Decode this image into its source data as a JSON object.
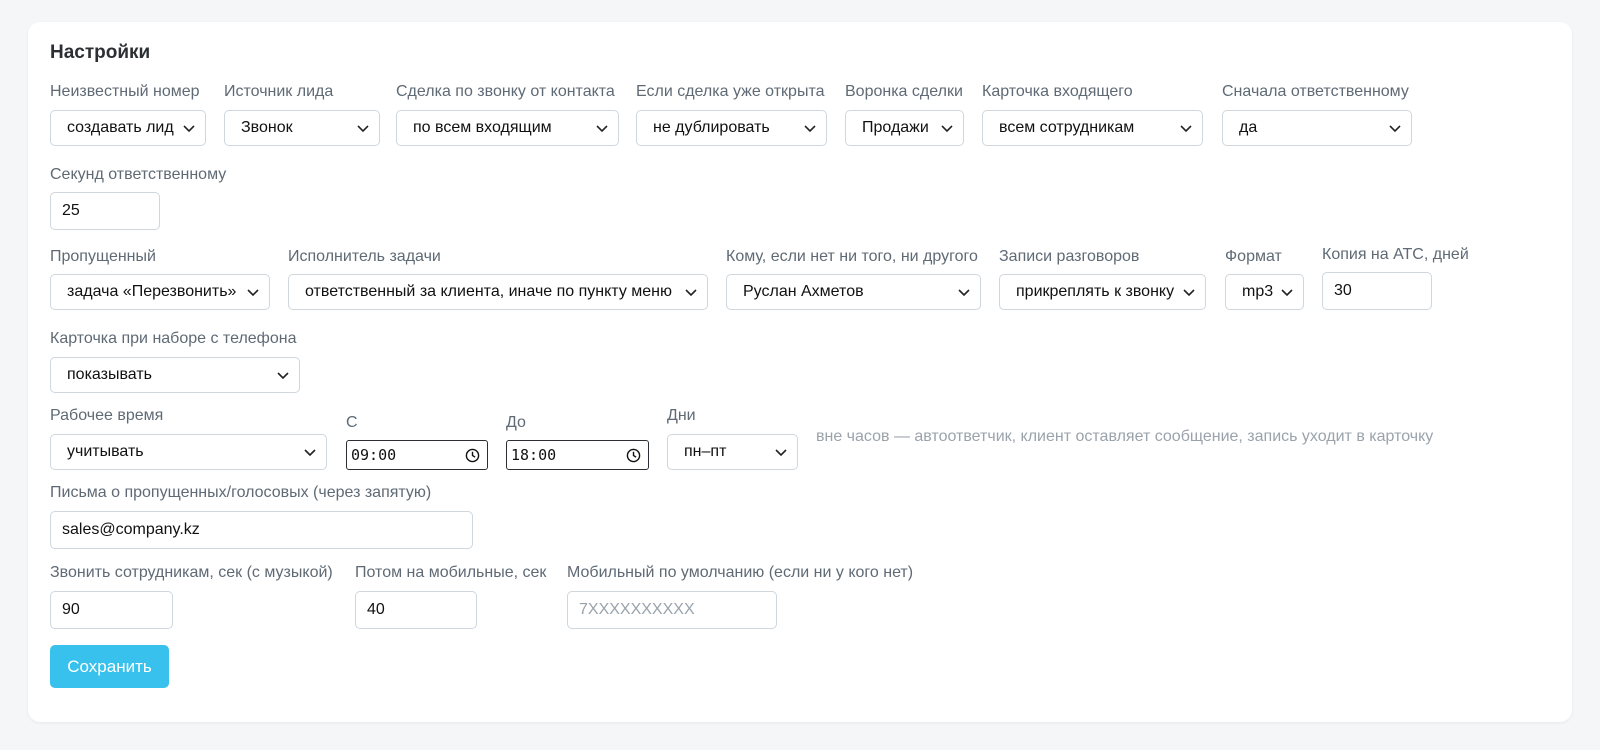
{
  "settings": {
    "title": "Настройки",
    "row1": {
      "unknown_number": {
        "label": "Неизвестный номер",
        "value": "создавать лид"
      },
      "lead_source": {
        "label": "Источник лида",
        "value": "Звонок"
      },
      "deal_by_call": {
        "label": "Сделка по звонку от контакта",
        "value": "по всем входящим"
      },
      "deal_open": {
        "label": "Если сделка уже открыта",
        "value": "не дублировать"
      },
      "funnel": {
        "label": "Воронка сделки",
        "value": "Продажи"
      },
      "incoming_card": {
        "label": "Карточка входящего",
        "value": "всем сотрудникам"
      },
      "responsible_first": {
        "label": "Сначала ответственному",
        "value": "да"
      }
    },
    "responsible_seconds": {
      "label": "Секунд ответственному",
      "value": "25"
    },
    "row3": {
      "missed": {
        "label": "Пропущенный",
        "value": "задача «Перезвонить»"
      },
      "task_executor": {
        "label": "Исполнитель задачи",
        "value": "ответственный за клиента, иначе по пункту меню"
      },
      "fallback_user": {
        "label": "Кому, если нет ни того, ни другого",
        "value": "Руслан Ахметов"
      },
      "recordings": {
        "label": "Записи разговоров",
        "value": "прикреплять к звонку"
      },
      "format": {
        "label": "Формат",
        "value": "mp3"
      },
      "ats_copy_days": {
        "label": "Копия на АТС, дней",
        "value": "30"
      }
    },
    "phone_dial_card": {
      "label": "Карточка при наборе с телефона",
      "value": "показывать"
    },
    "work_time": {
      "label": "Рабочее время",
      "value": "учитывать",
      "from_label": "С",
      "from_value": "09:00",
      "to_label": "До",
      "to_value": "18:00",
      "days_label": "Дни",
      "days_value": "пн–пт",
      "hint": "вне часов — автоответчик, клиент оставляет сообщение, запись уходит в карточку"
    },
    "emails": {
      "label": "Письма о пропущенных/голосовых (через запятую)",
      "value": "sales@company.kz"
    },
    "ring_staff": {
      "label": "Звонить сотрудникам, сек (с музыкой)",
      "value": "90"
    },
    "ring_mobile": {
      "label": "Потом на мобильные, сек",
      "value": "40"
    },
    "default_mobile": {
      "label": "Мобильный по умолчанию (если ни у кого нет)",
      "placeholder": "7XXXXXXXXXX"
    },
    "save_label": "Сохранить"
  },
  "colors": {
    "accent": "#38c1ec",
    "label": "#5f6a75",
    "hint": "#9aa3ab",
    "background": "#f4f6f8"
  }
}
